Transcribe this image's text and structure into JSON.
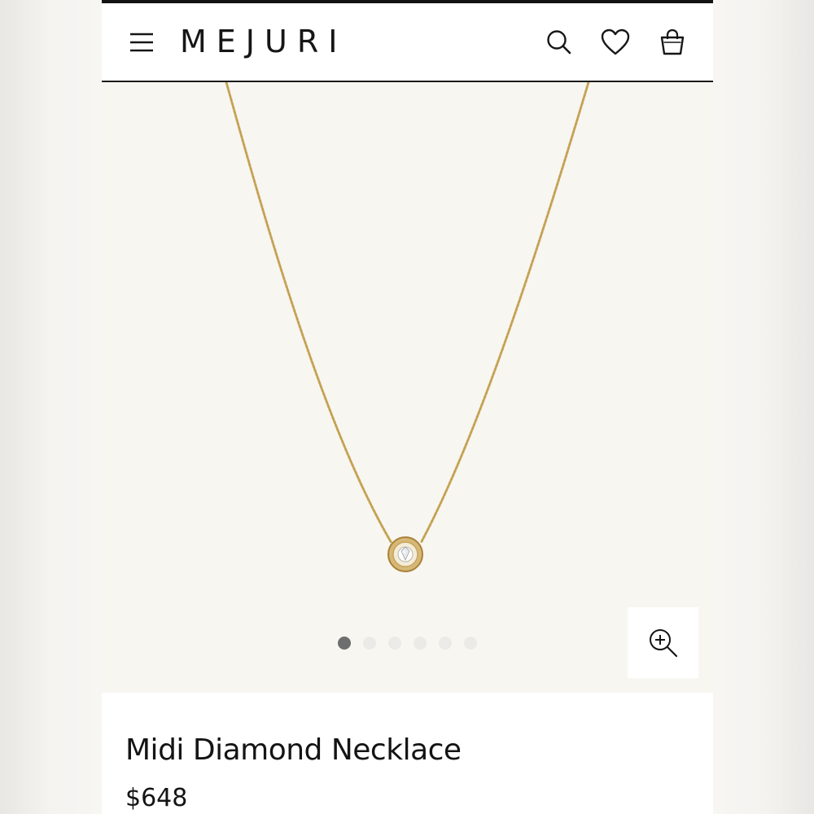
{
  "header": {
    "logo": "MEJURI",
    "menu_icon": "hamburger-menu-icon",
    "search_icon": "search-icon",
    "wishlist_icon": "heart-icon",
    "bag_icon": "shopping-bag-icon"
  },
  "gallery": {
    "image": "gold-necklace-with-diamond-bezel-pendant",
    "total_images": 6,
    "active_index": 1,
    "zoom_icon": "zoom-in-icon"
  },
  "product": {
    "name": "Midi Diamond Necklace",
    "price": "$648"
  },
  "colors": {
    "text": "#141414",
    "hero_background": "#f8f6f1",
    "gold": "#c9a85a",
    "active_dot": "#6e6e6e",
    "inactive_dot": "#eceae6"
  }
}
